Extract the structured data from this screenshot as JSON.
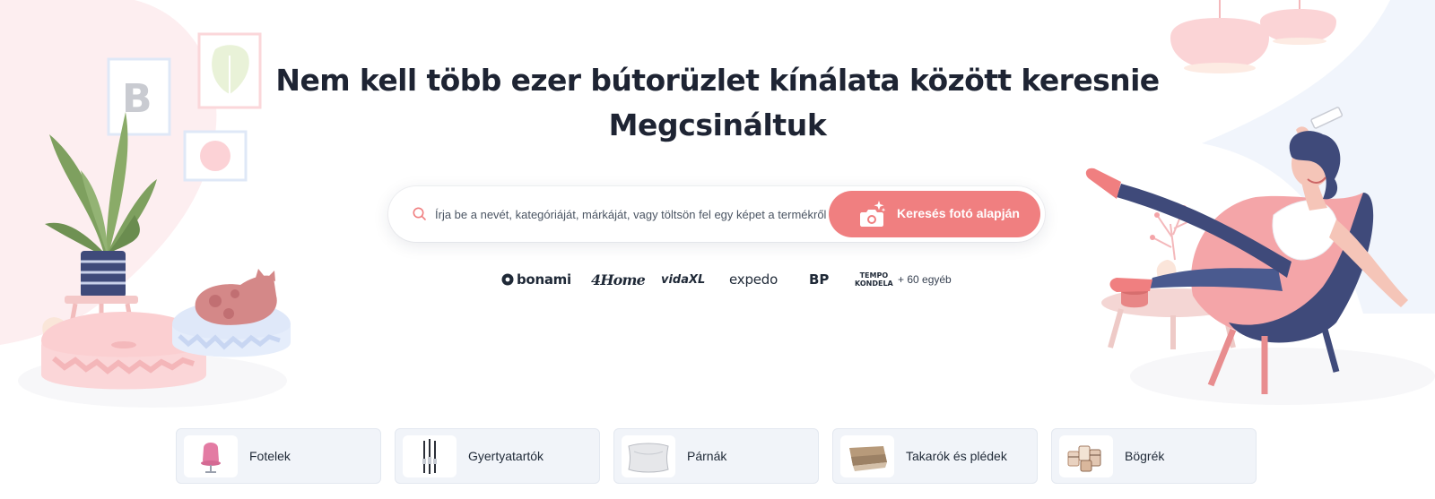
{
  "hero": {
    "title": "Nem kell több ezer bútorüzlet kínálata között keresnie",
    "subtitle": "Megcsináltuk"
  },
  "search": {
    "placeholder": "Írja be a nevét, kategóriáját, márkáját, vagy töltsön fel egy képet a termékről ...",
    "photo_button_label": "Keresés fotó alapján",
    "icon": "search-icon",
    "camera_icon": "camera-sparkle-icon"
  },
  "brands": {
    "items": [
      "bonami",
      "4Home",
      "vidaXL",
      "expedo",
      "BP",
      "TEMPO KONDELA"
    ],
    "tempo_top": "TEMPO",
    "tempo_bottom": "KONDELA",
    "more": "+ 60 egyéb"
  },
  "categories": [
    {
      "label": "Fotelek",
      "icon": "armchair-thumbnail"
    },
    {
      "label": "Gyertyatartók",
      "icon": "candle-holder-thumbnail"
    },
    {
      "label": "Párnák",
      "icon": "pillow-thumbnail"
    },
    {
      "label": "Takarók és plédek",
      "icon": "blanket-thumbnail"
    },
    {
      "label": "Bögrék",
      "icon": "mugs-thumbnail"
    }
  ],
  "colors": {
    "accent": "#f07f80",
    "title": "#1e2433",
    "card_bg": "#f1f4f9",
    "pink_soft": "#fde4e6",
    "blue_soft": "#e8eefa",
    "navy": "#3f4a7a"
  }
}
